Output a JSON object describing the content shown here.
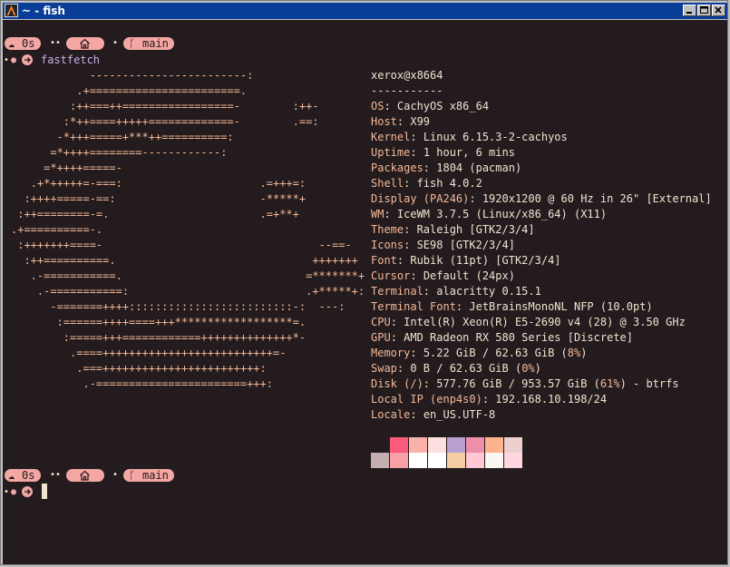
{
  "window": {
    "title": "~ - fish"
  },
  "prompt": {
    "time": "0s",
    "branch": "main"
  },
  "command": "fastfetch",
  "ascii_art": [
    "            ------------------------:",
    "          .+=======================.",
    "         :++===++=================-        :++-",
    "        :*++====+++++=============-        .==:",
    "       -*+++=====+***++==========:",
    "      =*++++========------------:",
    "     =*++++=====-",
    "   .+*+++++=-===:                     .=+++=:",
    "  :++++=====-==:                      -*****+",
    " :++========-=.                       .=+**+",
    ".+==========-.",
    " :+++++++====-                                 --==-",
    "  :++==========.                              +++++++",
    "   .-===========.                            =*******+",
    "    .-===========:                           .+*****+:",
    "      -=======++++:::::::::::::::::::::::::-:  ---:",
    "       :======++++====+++******************=.",
    "        :=====+++============++++++++++++++*-",
    "         .====++++++++++++++++++++++++++=-",
    "          .===++++++++++++++++++++++++:",
    "           .-=======================+++:"
  ],
  "info": {
    "user_host": "xerox@x8664",
    "separator": "-----------",
    "rows": [
      {
        "label": "OS",
        "value": "CachyOS x86_64"
      },
      {
        "label": "Host",
        "value": "X99"
      },
      {
        "label": "Kernel",
        "value": "Linux 6.15.3-2-cachyos"
      },
      {
        "label": "Uptime",
        "value": "1 hour, 6 mins"
      },
      {
        "label": "Packages",
        "value": "1804 (pacman)"
      },
      {
        "label": "Shell",
        "value": "fish 4.0.2"
      },
      {
        "label": "Display (PA246)",
        "value": "1920x1200 @ 60 Hz in 26\" [External]"
      },
      {
        "label": "WM",
        "value": "IceWM 3.7.5 (Linux/x86_64) (X11)"
      },
      {
        "label": "Theme",
        "value": "Raleigh [GTK2/3/4]"
      },
      {
        "label": "Icons",
        "value": "SE98 [GTK2/3/4]"
      },
      {
        "label": "Font",
        "value": "Rubik (11pt) [GTK2/3/4]"
      },
      {
        "label": "Cursor",
        "value": "Default (24px)"
      },
      {
        "label": "Terminal",
        "value": "alacritty 0.15.1"
      },
      {
        "label": "Terminal Font",
        "value": "JetBrainsMonoNL NFP (10.0pt)"
      },
      {
        "label": "CPU",
        "value": "Intel(R) Xeon(R) E5-2690 v4 (28) @ 3.50 GHz"
      },
      {
        "label": "GPU",
        "value": "AMD Radeon RX 580 Series [Discrete]"
      },
      {
        "label": "Memory",
        "value": "5.22 GiB / 62.63 GiB",
        "pct": "8%"
      },
      {
        "label": "Swap",
        "value": "0 B / 62.63 GiB",
        "pct": "0%"
      },
      {
        "label": "Disk (/)",
        "value": "577.76 GiB / 953.57 GiB",
        "pct": "61%",
        "suffix": " - btrfs"
      },
      {
        "label": "Local IP (enp4s0)",
        "value": "192.168.10.198/24"
      },
      {
        "label": "Locale",
        "value": "en_US.UTF-8"
      }
    ]
  },
  "palette": {
    "row1": [
      "#231b1d",
      "#fb5a7a",
      "#f8b2a9",
      "#fde0de",
      "#b7a0cf",
      "#ee8faa",
      "#fdb48c",
      "#ecd0d0"
    ],
    "row2": [
      "#c5aeb0",
      "#f8a0a8",
      "#ffffff",
      "#ffffff",
      "#f5cfa3",
      "#ffc8d4",
      "#fbf7f2",
      "#ffd6de"
    ]
  },
  "colors": {
    "bg": "#231b1d",
    "accent": "#f4a7a2",
    "text": "#f0e4d0",
    "label": "#f3b898",
    "title": "#0a3d97"
  }
}
